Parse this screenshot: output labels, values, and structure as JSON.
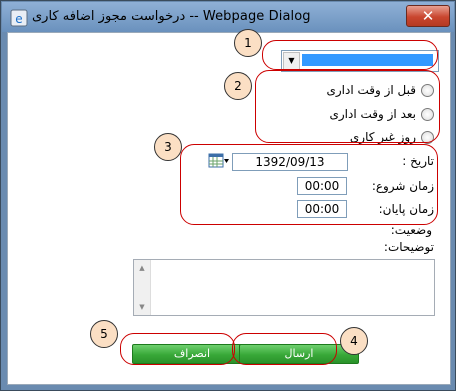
{
  "window": {
    "title": "درخواست مجوز اضافه کاری -- Webpage Dialog",
    "close_label": "✕"
  },
  "form": {
    "type_select": {
      "selected": ""
    },
    "radios": [
      {
        "label": "قبل از وقت اداری"
      },
      {
        "label": "بعد از وقت اداری"
      },
      {
        "label": "روز غیر کاری"
      }
    ],
    "date_label": "تاریخ :",
    "date_value": "1392/09/13",
    "start_label": "زمان شروع:",
    "start_value": "00:00",
    "end_label": "زمان پایان:",
    "end_value": "00:00",
    "status_label": "وضعیت:",
    "description_label": "توضیحات:",
    "description_value": ""
  },
  "buttons": {
    "cancel_label": "انصراف",
    "submit_label": "ارسال"
  },
  "callouts": [
    "1",
    "2",
    "3",
    "4",
    "5"
  ],
  "colors": {
    "accent_button": "#38a838",
    "callout": "#cc0000",
    "badge": "#fbdfc4"
  }
}
